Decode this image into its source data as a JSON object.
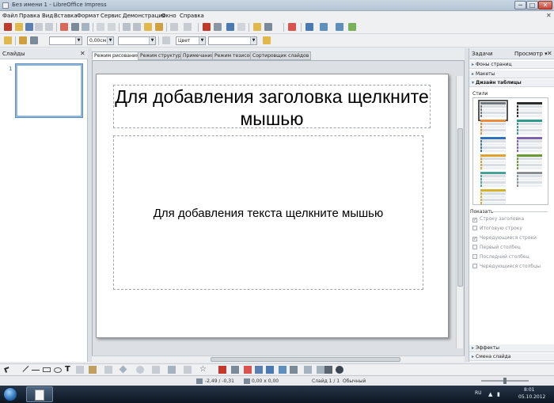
{
  "window": {
    "title": "Без имени 1 - LibreOffice Impress",
    "buttons": {
      "minimize": "─",
      "maximize": "□",
      "close": "✕"
    }
  },
  "menu": {
    "items": [
      "Файл",
      "Правка",
      "Вид",
      "Вставка",
      "Формат",
      "Сервис",
      "Демонстрация",
      "Окно",
      "Справка"
    ],
    "close_doc": "✕"
  },
  "formatting": {
    "line_width": "0,00см",
    "color": "Цвет"
  },
  "slides_pane": {
    "title": "Слайды",
    "close": "✕",
    "slide_number": "1"
  },
  "view_tabs": [
    "Режим рисования",
    "Режим структуры",
    "Примечания",
    "Режим тезисов",
    "Сортировщик слайдов"
  ],
  "slide": {
    "title_placeholder": "Для добавления заголовка щелкните мышью",
    "body_placeholder": "Для добавления текста щелкните мышью"
  },
  "tasks_pane": {
    "title": "Задачи",
    "view_menu": "Просмотр ▾",
    "close": "✕",
    "sections": {
      "page_backgrounds": "Фоны страниц",
      "layouts": "Макеты",
      "table_design": "Дизайн таблицы",
      "effects": "Эффекты",
      "slide_transition": "Смена слайда"
    },
    "styles_label": "Стили",
    "show_label": "Показать",
    "options": [
      {
        "label": "Строку заголовка",
        "checked": true
      },
      {
        "label": "Итоговую строку",
        "checked": false
      },
      {
        "label": "Чередующиеся строки",
        "checked": true
      },
      {
        "label": "Первый столбец",
        "checked": false
      },
      {
        "label": "Последний столбец",
        "checked": false
      },
      {
        "label": "Чередующиеся столбцы",
        "checked": false
      }
    ],
    "style_colors": [
      "#6f7680",
      "#2b2b2b",
      "#e98a3c",
      "#2e9a8e",
      "#2f6fbf",
      "#7b63b0",
      "#e0a02a",
      "#6a9a2e",
      "#46a39a",
      "#8a8f96",
      "#d4b12c"
    ]
  },
  "statusbar": {
    "position": "-2,49 / -0,31",
    "size": "0,00 x 0,00",
    "slide": "Слайд 1 / 1",
    "layout": "Обычный"
  },
  "taskbar": {
    "language": "RU",
    "time": "8:01",
    "date": "05.10.2012"
  }
}
